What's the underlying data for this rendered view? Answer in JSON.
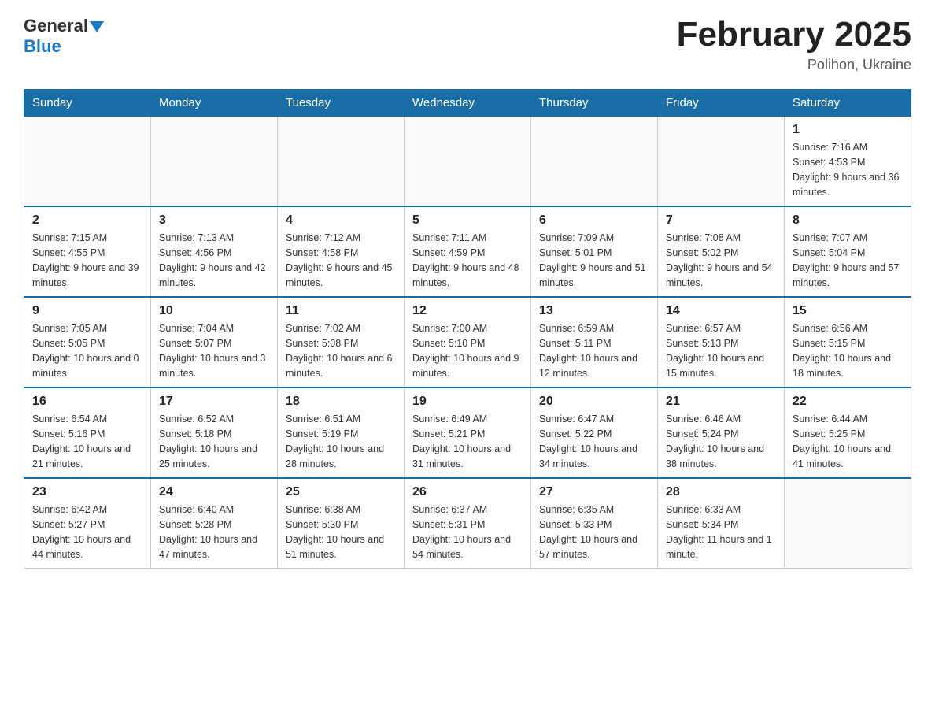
{
  "header": {
    "logo_general": "General",
    "logo_blue": "Blue",
    "month_title": "February 2025",
    "location": "Polihon, Ukraine"
  },
  "weekdays": [
    "Sunday",
    "Monday",
    "Tuesday",
    "Wednesday",
    "Thursday",
    "Friday",
    "Saturday"
  ],
  "weeks": [
    [
      {
        "day": "",
        "info": ""
      },
      {
        "day": "",
        "info": ""
      },
      {
        "day": "",
        "info": ""
      },
      {
        "day": "",
        "info": ""
      },
      {
        "day": "",
        "info": ""
      },
      {
        "day": "",
        "info": ""
      },
      {
        "day": "1",
        "info": "Sunrise: 7:16 AM\nSunset: 4:53 PM\nDaylight: 9 hours and 36 minutes."
      }
    ],
    [
      {
        "day": "2",
        "info": "Sunrise: 7:15 AM\nSunset: 4:55 PM\nDaylight: 9 hours and 39 minutes."
      },
      {
        "day": "3",
        "info": "Sunrise: 7:13 AM\nSunset: 4:56 PM\nDaylight: 9 hours and 42 minutes."
      },
      {
        "day": "4",
        "info": "Sunrise: 7:12 AM\nSunset: 4:58 PM\nDaylight: 9 hours and 45 minutes."
      },
      {
        "day": "5",
        "info": "Sunrise: 7:11 AM\nSunset: 4:59 PM\nDaylight: 9 hours and 48 minutes."
      },
      {
        "day": "6",
        "info": "Sunrise: 7:09 AM\nSunset: 5:01 PM\nDaylight: 9 hours and 51 minutes."
      },
      {
        "day": "7",
        "info": "Sunrise: 7:08 AM\nSunset: 5:02 PM\nDaylight: 9 hours and 54 minutes."
      },
      {
        "day": "8",
        "info": "Sunrise: 7:07 AM\nSunset: 5:04 PM\nDaylight: 9 hours and 57 minutes."
      }
    ],
    [
      {
        "day": "9",
        "info": "Sunrise: 7:05 AM\nSunset: 5:05 PM\nDaylight: 10 hours and 0 minutes."
      },
      {
        "day": "10",
        "info": "Sunrise: 7:04 AM\nSunset: 5:07 PM\nDaylight: 10 hours and 3 minutes."
      },
      {
        "day": "11",
        "info": "Sunrise: 7:02 AM\nSunset: 5:08 PM\nDaylight: 10 hours and 6 minutes."
      },
      {
        "day": "12",
        "info": "Sunrise: 7:00 AM\nSunset: 5:10 PM\nDaylight: 10 hours and 9 minutes."
      },
      {
        "day": "13",
        "info": "Sunrise: 6:59 AM\nSunset: 5:11 PM\nDaylight: 10 hours and 12 minutes."
      },
      {
        "day": "14",
        "info": "Sunrise: 6:57 AM\nSunset: 5:13 PM\nDaylight: 10 hours and 15 minutes."
      },
      {
        "day": "15",
        "info": "Sunrise: 6:56 AM\nSunset: 5:15 PM\nDaylight: 10 hours and 18 minutes."
      }
    ],
    [
      {
        "day": "16",
        "info": "Sunrise: 6:54 AM\nSunset: 5:16 PM\nDaylight: 10 hours and 21 minutes."
      },
      {
        "day": "17",
        "info": "Sunrise: 6:52 AM\nSunset: 5:18 PM\nDaylight: 10 hours and 25 minutes."
      },
      {
        "day": "18",
        "info": "Sunrise: 6:51 AM\nSunset: 5:19 PM\nDaylight: 10 hours and 28 minutes."
      },
      {
        "day": "19",
        "info": "Sunrise: 6:49 AM\nSunset: 5:21 PM\nDaylight: 10 hours and 31 minutes."
      },
      {
        "day": "20",
        "info": "Sunrise: 6:47 AM\nSunset: 5:22 PM\nDaylight: 10 hours and 34 minutes."
      },
      {
        "day": "21",
        "info": "Sunrise: 6:46 AM\nSunset: 5:24 PM\nDaylight: 10 hours and 38 minutes."
      },
      {
        "day": "22",
        "info": "Sunrise: 6:44 AM\nSunset: 5:25 PM\nDaylight: 10 hours and 41 minutes."
      }
    ],
    [
      {
        "day": "23",
        "info": "Sunrise: 6:42 AM\nSunset: 5:27 PM\nDaylight: 10 hours and 44 minutes."
      },
      {
        "day": "24",
        "info": "Sunrise: 6:40 AM\nSunset: 5:28 PM\nDaylight: 10 hours and 47 minutes."
      },
      {
        "day": "25",
        "info": "Sunrise: 6:38 AM\nSunset: 5:30 PM\nDaylight: 10 hours and 51 minutes."
      },
      {
        "day": "26",
        "info": "Sunrise: 6:37 AM\nSunset: 5:31 PM\nDaylight: 10 hours and 54 minutes."
      },
      {
        "day": "27",
        "info": "Sunrise: 6:35 AM\nSunset: 5:33 PM\nDaylight: 10 hours and 57 minutes."
      },
      {
        "day": "28",
        "info": "Sunrise: 6:33 AM\nSunset: 5:34 PM\nDaylight: 11 hours and 1 minute."
      },
      {
        "day": "",
        "info": ""
      }
    ]
  ]
}
